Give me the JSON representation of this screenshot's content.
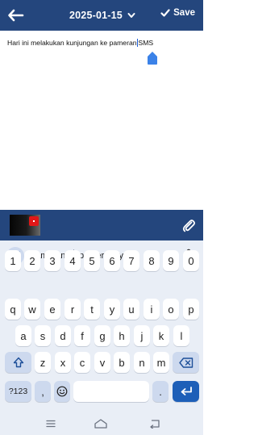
{
  "header": {
    "date": "2025-01-15",
    "save_label": "Save",
    "colors": {
      "bar": "#24467d",
      "text": "#ffffff"
    },
    "icons": [
      "back-arrow-icon",
      "chevron-down-icon",
      "check-icon"
    ]
  },
  "editor": {
    "text_before_caret": "Hari ini melakukan kunjungan ke pameran",
    "text_after_caret": "SMS"
  },
  "attachment_bar": {
    "icons": [
      "video-thumbnail",
      "paperclip-icon"
    ]
  },
  "keyboard": {
    "suggestions": [
      "pameran",
      "pamerannya"
    ],
    "rows": [
      [
        "1",
        "2",
        "3",
        "4",
        "5",
        "6",
        "7",
        "8",
        "9",
        "0"
      ],
      [
        "q",
        "w",
        "e",
        "r",
        "t",
        "y",
        "u",
        "i",
        "o",
        "p"
      ],
      [
        "a",
        "s",
        "d",
        "f",
        "g",
        "h",
        "j",
        "k",
        "l"
      ],
      [
        "z",
        "x",
        "c",
        "v",
        "b",
        "n",
        "m"
      ]
    ],
    "symbols_key": "?123",
    "comma_key": ",",
    "period_key": ".",
    "accent": "#1d5fb8"
  },
  "navigation": {
    "icons": [
      "menu-icon",
      "home-icon",
      "back-icon"
    ]
  }
}
